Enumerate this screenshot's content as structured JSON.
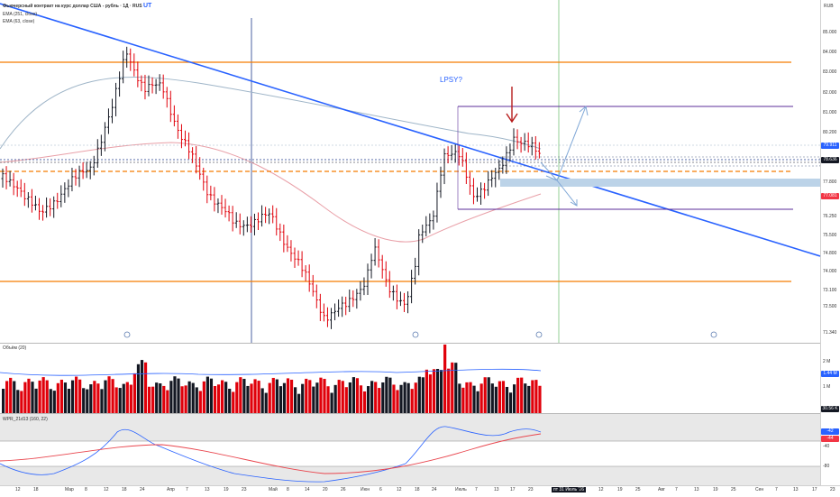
{
  "header": {
    "title": "Фьючерсный контракт на курс доллар США - рубль · 1Д · RUS",
    "title_suffix": "UT",
    "currency": "RUB",
    "ema1": "EMA (251, close)",
    "ema2": "EMA (63, close)"
  },
  "annotations": {
    "lpsy": "LPSY?"
  },
  "price_axis": {
    "labels": [
      "85.000",
      "84.000",
      "83.000",
      "82.000",
      "81.000",
      "80.200",
      "78.600",
      "77.800",
      "76.250",
      "75.500",
      "74.800",
      "74.000",
      "73.100",
      "72.500",
      "71.340"
    ],
    "current_tags": [
      {
        "value": "79.911",
        "color": "#2962ff"
      },
      {
        "value": "78.636",
        "color": "#131722"
      },
      {
        "value": "77.081",
        "color": "#f23645"
      }
    ]
  },
  "volume": {
    "legend": "Объём (20)",
    "axis_labels": [
      "2 M",
      "1 M"
    ],
    "tags": [
      {
        "value": "1.44 M",
        "color": "#2962ff"
      },
      {
        "value": "30.56 K",
        "color": "#131722"
      }
    ]
  },
  "wpr": {
    "legend": "WPR_21d13 (160, 22)",
    "axis_labels": [
      "-40",
      "-80"
    ],
    "tags": [
      {
        "value": "-42",
        "color": "#2962ff"
      },
      {
        "value": "-44",
        "color": "#f23645"
      }
    ]
  },
  "time_axis": {
    "labels": [
      "12",
      "18",
      "Мар",
      "8",
      "12",
      "18",
      "24",
      "Апр",
      "7",
      "13",
      "19",
      "23",
      "Май",
      "8",
      "14",
      "20",
      "26",
      "Июн",
      "6",
      "12",
      "18",
      "24",
      "Июль",
      "7",
      "13",
      "17",
      "23",
      "пт 31 Июль '26",
      "7",
      "12",
      "19",
      "25",
      "Авг",
      "7",
      "13",
      "19",
      "25",
      "Сен",
      "7",
      "13",
      "17",
      "23",
      "Окт",
      "7",
      "13",
      "19"
    ],
    "highlight": "пт 31 Июль '26"
  },
  "colors": {
    "up": "#131722",
    "down": "#e0000a",
    "trend": "#2962ff",
    "level": "#f57c00",
    "box": "#5b2c9a"
  }
}
